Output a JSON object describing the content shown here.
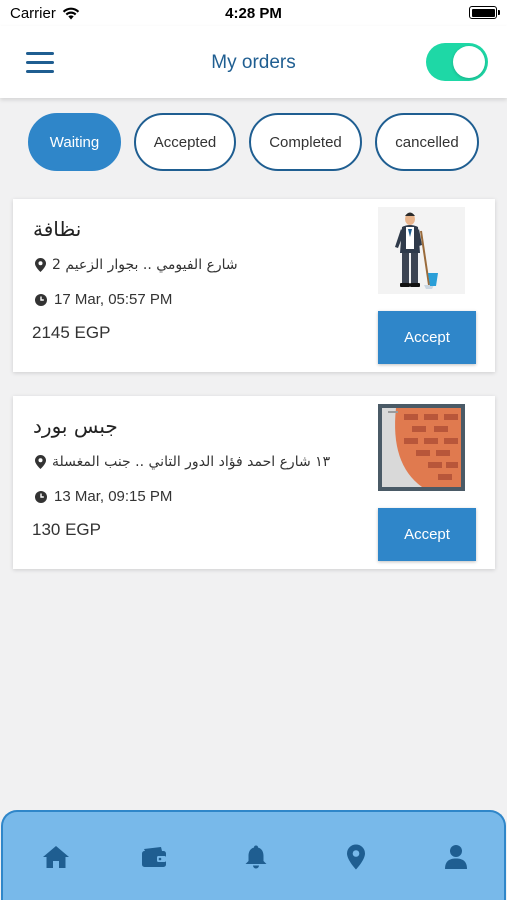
{
  "status_bar": {
    "carrier": "Carrier",
    "time": "4:28 PM"
  },
  "header": {
    "title": "My orders",
    "toggle_on": true,
    "toggle_color": "#1ed8a6"
  },
  "tabs": [
    {
      "label": "Waiting",
      "active": true
    },
    {
      "label": "Accepted",
      "active": false
    },
    {
      "label": "Completed",
      "active": false
    },
    {
      "label": "cancelled",
      "active": false
    }
  ],
  "orders": [
    {
      "title": "نظافة",
      "address": "شارع الفيومي .. بجوار الزعيم 2",
      "date": "17 Mar, 05:57 PM",
      "price": "2145 EGP",
      "image_icon": "cleaner-illustration-icon",
      "accept_label": "Accept"
    },
    {
      "title": "جبس بورد",
      "address": "١٣ شارع احمد فؤاد الدور التاني .. جنب المغسلة",
      "date": "13 Mar, 09:15 PM",
      "price": "130 EGP",
      "image_icon": "brick-wall-icon",
      "accept_label": "Accept"
    }
  ],
  "bottom_nav": [
    {
      "icon": "home-icon"
    },
    {
      "icon": "wallet-icon"
    },
    {
      "icon": "bell-icon",
      "active": true
    },
    {
      "icon": "location-pin-icon"
    },
    {
      "icon": "user-icon"
    }
  ],
  "colors": {
    "primary": "#2f86c9",
    "primary_dark": "#1f5e91",
    "nav_background": "#78b9ea",
    "background": "#f1f1f2"
  }
}
